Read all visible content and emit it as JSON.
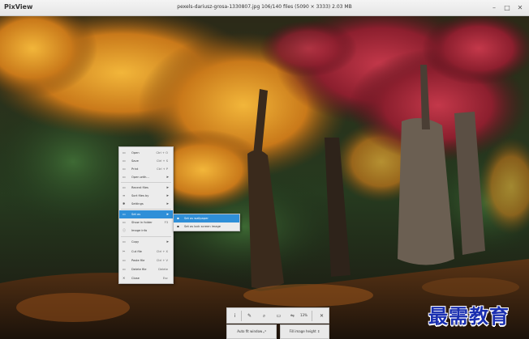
{
  "app": {
    "name": "PixView",
    "window_title": "pexels-dariusz-grosa-1330807.jpg 106/140 files (5090 × 3333) 2.03 MB"
  },
  "window_controls": [
    "–",
    "□",
    "✕"
  ],
  "context_menu": {
    "items": [
      {
        "icon": "folder-open-icon",
        "glyph": "▭",
        "label": "Open",
        "shortcut": "Ctrl + O",
        "submenu": false
      },
      {
        "icon": "save-icon",
        "glyph": "▭",
        "label": "Save",
        "shortcut": "Ctrl + S",
        "submenu": false
      },
      {
        "icon": "print-icon",
        "glyph": "▭",
        "label": "Print",
        "shortcut": "Ctrl + P",
        "submenu": false
      },
      {
        "icon": "open-with-icon",
        "glyph": "▭",
        "label": "Open with...",
        "shortcut": "",
        "submenu": true
      },
      {
        "icon": "recent-files-icon",
        "glyph": "▭",
        "label": "Recent files",
        "shortcut": "",
        "submenu": true
      },
      {
        "icon": "sort-icon",
        "glyph": "≡",
        "label": "Sort files by",
        "shortcut": "",
        "submenu": true
      },
      {
        "icon": "settings-icon",
        "glyph": "✱",
        "label": "Settings",
        "shortcut": "",
        "submenu": true
      },
      {
        "icon": "set-as-icon",
        "glyph": "▭",
        "label": "Set as",
        "shortcut": "",
        "submenu": true
      },
      {
        "icon": "show-in-folder-icon",
        "glyph": "▭",
        "label": "Show in folder",
        "shortcut": "F3",
        "submenu": false
      },
      {
        "icon": "image-info-icon",
        "glyph": "ⓘ",
        "label": "Image info",
        "shortcut": "",
        "submenu": false
      },
      {
        "icon": "copy-icon",
        "glyph": "▭",
        "label": "Copy",
        "shortcut": "",
        "submenu": true
      },
      {
        "icon": "cut-icon",
        "glyph": "✂",
        "label": "Cut file",
        "shortcut": "Ctrl + X",
        "submenu": false
      },
      {
        "icon": "paste-icon",
        "glyph": "▭",
        "label": "Paste file",
        "shortcut": "Ctrl + V",
        "submenu": false
      },
      {
        "icon": "delete-icon",
        "glyph": "▭",
        "label": "Delete file",
        "shortcut": "Delete",
        "submenu": false
      },
      {
        "icon": "close-icon",
        "glyph": "✕",
        "label": "Close",
        "shortcut": "Esc",
        "submenu": false
      }
    ]
  },
  "submenu": {
    "items": [
      {
        "icon": "wallpaper-icon",
        "label": "Set as wallpaper"
      },
      {
        "icon": "lock-screen-icon",
        "label": "Set as lock screen image"
      }
    ]
  },
  "toolbar": {
    "buttons": [
      {
        "name": "info-button",
        "icon": "info-icon",
        "glyph": "ⅰ"
      },
      {
        "name": "edit-button",
        "icon": "wrench-icon",
        "glyph": "✎"
      },
      {
        "name": "zoom-button",
        "icon": "search-icon",
        "glyph": "⌕"
      },
      {
        "name": "comment-button",
        "icon": "speech-bubble-icon",
        "glyph": "▭"
      },
      {
        "name": "flip-button",
        "icon": "flip-icon",
        "glyph": "⇋"
      }
    ],
    "zoom_level": "13%",
    "close_glyph": "✕",
    "auto_fit_label": "Auto fit window",
    "auto_fit_glyph": "⤢",
    "fill_height_label": "Fill image height",
    "fill_height_glyph": "⇕"
  },
  "watermark": "最需教育"
}
